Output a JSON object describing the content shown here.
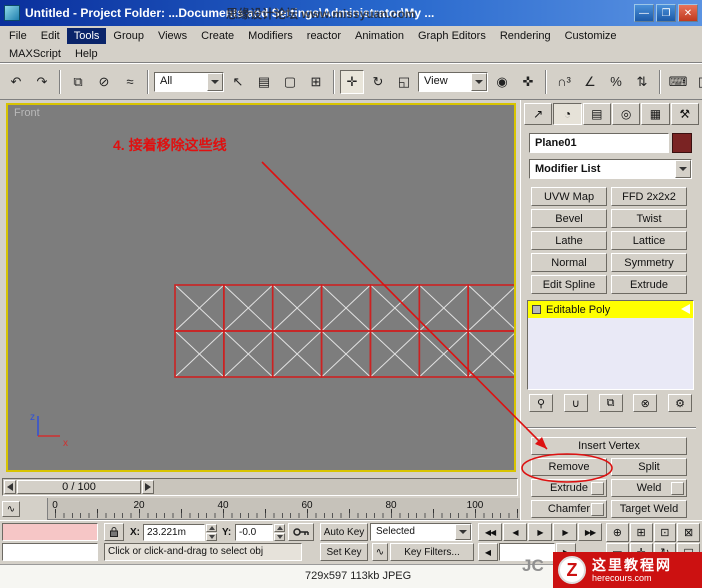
{
  "colors": {
    "selection_highlight": "#ffff00",
    "annotation_red": "#dd1111",
    "watermark_bg": "#cc1111",
    "titlebar_blue": "#1c55c0"
  },
  "titlebar": {
    "title": "Untitled    -  Project Folder: ...Documents and Settings\\Administrator\\My ...",
    "watermark": "思缘设计论坛 www.missyuan.com",
    "buttons": {
      "minimize": "—",
      "maximize": "❐",
      "close": "✕"
    }
  },
  "menu": {
    "row1": [
      {
        "name": "menu-file",
        "label": "File"
      },
      {
        "name": "menu-edit",
        "label": "Edit"
      },
      {
        "name": "menu-tools",
        "label": "Tools",
        "active": true
      },
      {
        "name": "menu-group",
        "label": "Group"
      },
      {
        "name": "menu-views",
        "label": "Views"
      },
      {
        "name": "menu-create",
        "label": "Create"
      },
      {
        "name": "menu-modifiers",
        "label": "Modifiers"
      },
      {
        "name": "menu-reactor",
        "label": "reactor"
      },
      {
        "name": "menu-animation",
        "label": "Animation"
      },
      {
        "name": "menu-graph-editors",
        "label": "Graph Editors"
      },
      {
        "name": "menu-rendering",
        "label": "Rendering"
      },
      {
        "name": "menu-customize",
        "label": "Customize"
      }
    ],
    "row2": [
      {
        "name": "menu-maxscript",
        "label": "MAXScript"
      },
      {
        "name": "menu-help",
        "label": "Help"
      }
    ]
  },
  "toolbar": {
    "filter_value": "All",
    "coordsys_value": "View",
    "group1": [
      {
        "name": "undo-icon",
        "glyph": "↶"
      },
      {
        "name": "redo-icon",
        "glyph": "↷"
      }
    ],
    "group2": [
      {
        "name": "select-link-icon",
        "glyph": "⧉"
      },
      {
        "name": "unlink-selection-icon",
        "glyph": "⊘"
      },
      {
        "name": "bind-spacewarp-icon",
        "glyph": "≈"
      }
    ],
    "group3": [
      {
        "name": "select-object-icon",
        "glyph": "↖"
      },
      {
        "name": "select-by-name-icon",
        "glyph": "▤"
      },
      {
        "name": "selection-region-icon",
        "glyph": "▢"
      },
      {
        "name": "window-crossing-icon",
        "glyph": "⊞"
      }
    ],
    "group4": [
      {
        "name": "select-move-icon",
        "glyph": "✛",
        "active": true
      },
      {
        "name": "select-rotate-icon",
        "glyph": "↻"
      },
      {
        "name": "select-scale-icon",
        "glyph": "◱"
      }
    ],
    "group5": [
      {
        "name": "use-pivot-center-icon",
        "glyph": "◉"
      },
      {
        "name": "select-manipulate-icon",
        "glyph": "✜"
      }
    ],
    "group6": [
      {
        "name": "snap-toggle-icon",
        "glyph": "∩³"
      },
      {
        "name": "angle-snap-icon",
        "glyph": "∠"
      },
      {
        "name": "percent-snap-icon",
        "glyph": "%"
      },
      {
        "name": "spinner-snap-icon",
        "glyph": "⇅"
      }
    ],
    "group7": [
      {
        "name": "keyboard-override-icon",
        "glyph": "⌨"
      },
      {
        "name": "mirror-icon",
        "glyph": "◫"
      },
      {
        "name": "align-icon",
        "glyph": "≣"
      },
      {
        "name": "curve-editor-icon",
        "glyph": "∿"
      }
    ]
  },
  "viewport": {
    "label": "Front",
    "annotation": "4. 接着移除这些线",
    "axis_z": "z",
    "axis_x": "x"
  },
  "command_panel": {
    "tabs": [
      {
        "name": "create-tab",
        "glyph": "↗"
      },
      {
        "name": "modify-tab",
        "glyph": "◔",
        "active": true
      },
      {
        "name": "hierarchy-tab",
        "glyph": "▤"
      },
      {
        "name": "motion-tab",
        "glyph": "◎"
      },
      {
        "name": "display-tab",
        "glyph": "▦"
      },
      {
        "name": "utilities-tab",
        "glyph": "⚒"
      }
    ],
    "object_name": "Plane01",
    "modifier_list": "Modifier List",
    "modifier_buttons": [
      {
        "name": "uvw-map-button",
        "label": "UVW Map"
      },
      {
        "name": "ffd-2x2x2-button",
        "label": "FFD 2x2x2"
      },
      {
        "name": "bevel-button",
        "label": "Bevel"
      },
      {
        "name": "twist-button",
        "label": "Twist"
      },
      {
        "name": "lathe-button",
        "label": "Lathe"
      },
      {
        "name": "lattice-button",
        "label": "Lattice"
      },
      {
        "name": "normal-button",
        "label": "Normal"
      },
      {
        "name": "symmetry-button",
        "label": "Symmetry"
      },
      {
        "name": "edit-spline-button",
        "label": "Edit Spline"
      },
      {
        "name": "extrude-modifier-button",
        "label": "Extrude"
      }
    ],
    "stack_entry": "Editable Poly",
    "stack_icons": [
      {
        "name": "pin-stack-icon",
        "glyph": "⚲"
      },
      {
        "name": "show-end-result-icon",
        "glyph": "∪"
      },
      {
        "name": "make-unique-icon",
        "glyph": "⧉"
      },
      {
        "name": "remove-modifier-icon",
        "glyph": "⊗"
      },
      {
        "name": "configure-modifier-sets-icon",
        "glyph": "⚙"
      }
    ],
    "edit": {
      "insert_vertex": "Insert Vertex",
      "remove": "Remove",
      "split": "Split",
      "extrude": "Extrude",
      "weld": "Weld",
      "chamfer": "Chamfer",
      "target_weld": "Target Weld"
    }
  },
  "timeline": {
    "slider_value": "0 / 100",
    "ticks": [
      "0",
      "20",
      "40",
      "60",
      "80",
      "100"
    ]
  },
  "status": {
    "x_label": "X:",
    "x_value": "23.221m",
    "y_label": "Y:",
    "y_value": "-0.0",
    "auto_key": "Auto Key",
    "set_key": "Set Key",
    "selection_set": "Selected",
    "key_filters": "Key Filters...",
    "prompt": "Click or click-and-drag to select obj",
    "playback": [
      {
        "name": "go-to-start-button",
        "glyph": "◀◀"
      },
      {
        "name": "previous-frame-button",
        "glyph": "◀"
      },
      {
        "name": "play-button",
        "glyph": "▶"
      },
      {
        "name": "next-frame-button",
        "glyph": "▶"
      },
      {
        "name": "go-to-end-button",
        "glyph": "▶▶"
      }
    ],
    "nav_icons": [
      {
        "name": "zoom-icon",
        "glyph": "⊕"
      },
      {
        "name": "zoom-all-icon",
        "glyph": "⊞"
      },
      {
        "name": "zoom-extents-icon",
        "glyph": "⊡"
      },
      {
        "name": "zoom-extents-all-icon",
        "glyph": "⊠"
      },
      {
        "name": "field-of-view-icon",
        "glyph": "▭"
      },
      {
        "name": "pan-icon",
        "glyph": "✛"
      },
      {
        "name": "arc-rotate-icon",
        "glyph": "↻"
      },
      {
        "name": "min-max-toggle-icon",
        "glyph": "◱"
      }
    ]
  },
  "footer": {
    "image_info": "729x597 113kb JPEG",
    "jc": "JC"
  },
  "watermark": {
    "site_name": "这里教程网",
    "site_url": "herecours.com",
    "logo_letter": "Z"
  }
}
